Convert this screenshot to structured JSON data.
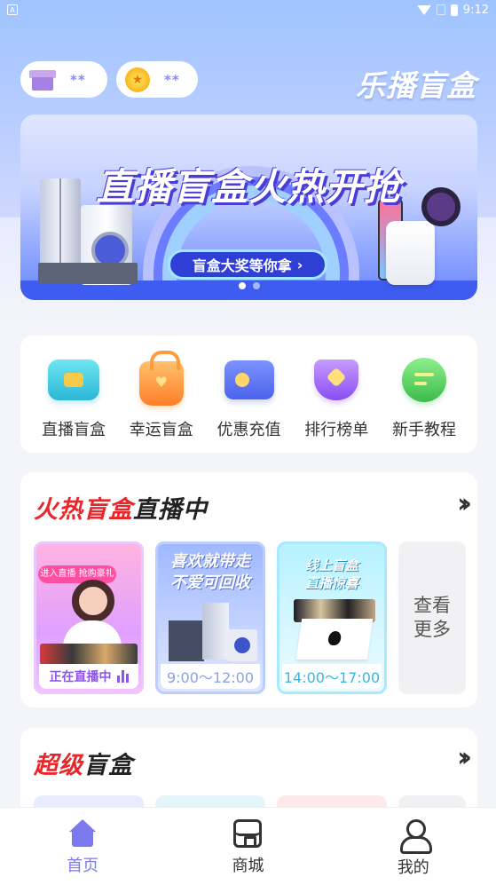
{
  "status_bar": {
    "time": "9:12",
    "app_indicator": "A"
  },
  "header": {
    "brand": "乐播盲盒",
    "box_balance": "**",
    "coin_balance": "**"
  },
  "banner": {
    "headline": "直播盲盒火热开抢",
    "sub_button": "盲盒大奖等你拿",
    "page_count": 2,
    "active_page": 1
  },
  "quick_nav": [
    {
      "label": "直播盲盒",
      "icon": "tv-play-icon"
    },
    {
      "label": "幸运盲盒",
      "icon": "lucky-bag-icon"
    },
    {
      "label": "优惠充值",
      "icon": "wallet-icon"
    },
    {
      "label": "排行榜单",
      "icon": "trophy-icon"
    },
    {
      "label": "新手教程",
      "icon": "tutorial-icon"
    }
  ],
  "hot_section": {
    "title_red": "火热盲盒",
    "title_dark": "直播中",
    "cards": [
      {
        "tag": "进入直播 抢购豪礼",
        "badge": "正在直播中"
      },
      {
        "title_line1": "喜欢就带走",
        "title_line2": "不爱可回收",
        "badge": "9:00～12:00"
      },
      {
        "title_line1": "线上盲盒",
        "title_line2": "直播惊喜",
        "badge": "14:00～17:00"
      }
    ],
    "see_more": "查看更多"
  },
  "super_section": {
    "title_red": "超级",
    "title_dark": "盲盒"
  },
  "tab_bar": [
    {
      "label": "首页",
      "icon": "home-icon",
      "active": true
    },
    {
      "label": "商城",
      "icon": "shop-icon",
      "active": false
    },
    {
      "label": "我的",
      "icon": "profile-icon",
      "active": false
    }
  ],
  "colors": {
    "accent": "#7a7aee",
    "hot_red": "#e8262b",
    "header_gradient_top": "#9fc4ff"
  }
}
